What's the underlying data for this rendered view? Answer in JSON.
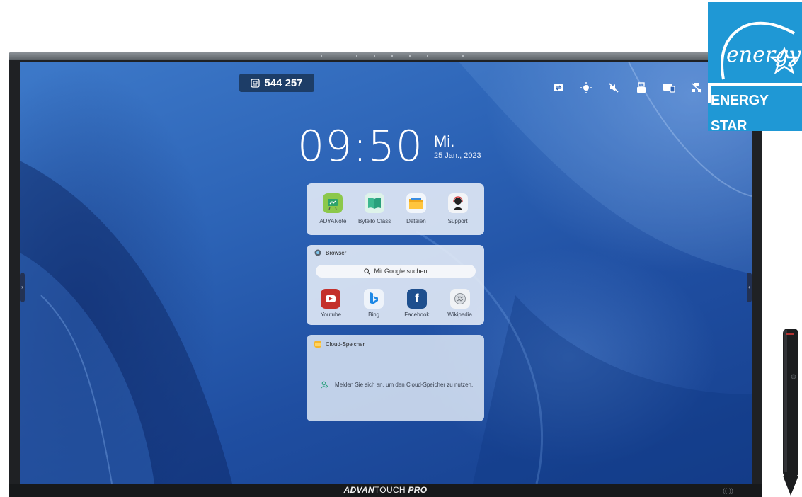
{
  "session_code": "544 257",
  "clock": {
    "time": "09:50",
    "weekday": "Mi.",
    "date": "25 Jan., 2023"
  },
  "apps": [
    {
      "label": "ADYANote",
      "icon": "note-board-icon"
    },
    {
      "label": "Bytello Class",
      "icon": "book-icon"
    },
    {
      "label": "Dateien",
      "icon": "folder-icon"
    },
    {
      "label": "Support",
      "icon": "support-agent-icon"
    }
  ],
  "browser": {
    "title": "Browser",
    "search_placeholder": "Mit Google suchen",
    "shortcuts": [
      {
        "label": "Youtube",
        "icon": "youtube-icon",
        "color": "#c4302b"
      },
      {
        "label": "Bing",
        "icon": "bing-icon",
        "color": "#1e88e5"
      },
      {
        "label": "Facebook",
        "icon": "facebook-icon",
        "color": "#1e4f8e"
      },
      {
        "label": "Wikipedia",
        "icon": "wikipedia-icon",
        "color": "#9aa0a6"
      }
    ]
  },
  "cloud": {
    "title": "Cloud-Speicher",
    "message": "Melden Sie sich an, um den Cloud-Speicher zu nutzen."
  },
  "status_icons": [
    "screen-share-icon",
    "brightness-icon",
    "mute-icon",
    "usb-icon",
    "display-icon",
    "network-icon",
    "wifi-icon"
  ],
  "brand": {
    "bold": "ADVAN",
    "regular": "TOUCH ",
    "italic": "PRO"
  },
  "sensor_mark": "((·))",
  "energy_star": {
    "script": "energy",
    "label": "ENERGY STAR"
  },
  "colors": {
    "accent_blue": "#2c63b6",
    "energy_star_blue": "#1f98d5",
    "code_pill": "#1d3d67"
  }
}
